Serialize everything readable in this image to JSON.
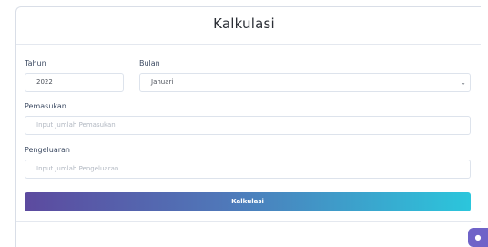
{
  "form": {
    "title": "Kalkulasi",
    "year_label": "Tahun",
    "year_value": "2022",
    "month_label": "Bulan",
    "month_selected": "Januari",
    "income_label": "Pemasukan",
    "income_placeholder": "Input Jumlah Pemasukan",
    "expense_label": "Pengeluaran",
    "expense_placeholder": "Input Jumlah Pengeluaran",
    "submit_label": "Kalkulasi"
  },
  "icons": {
    "month_dropdown": "chevron-down-icon",
    "floating_action": "chat-icon"
  },
  "colors": {
    "button_gradient_start": "#5c4a9f",
    "button_gradient_end": "#2bc6dc",
    "floating_button": "#6f63c8"
  }
}
